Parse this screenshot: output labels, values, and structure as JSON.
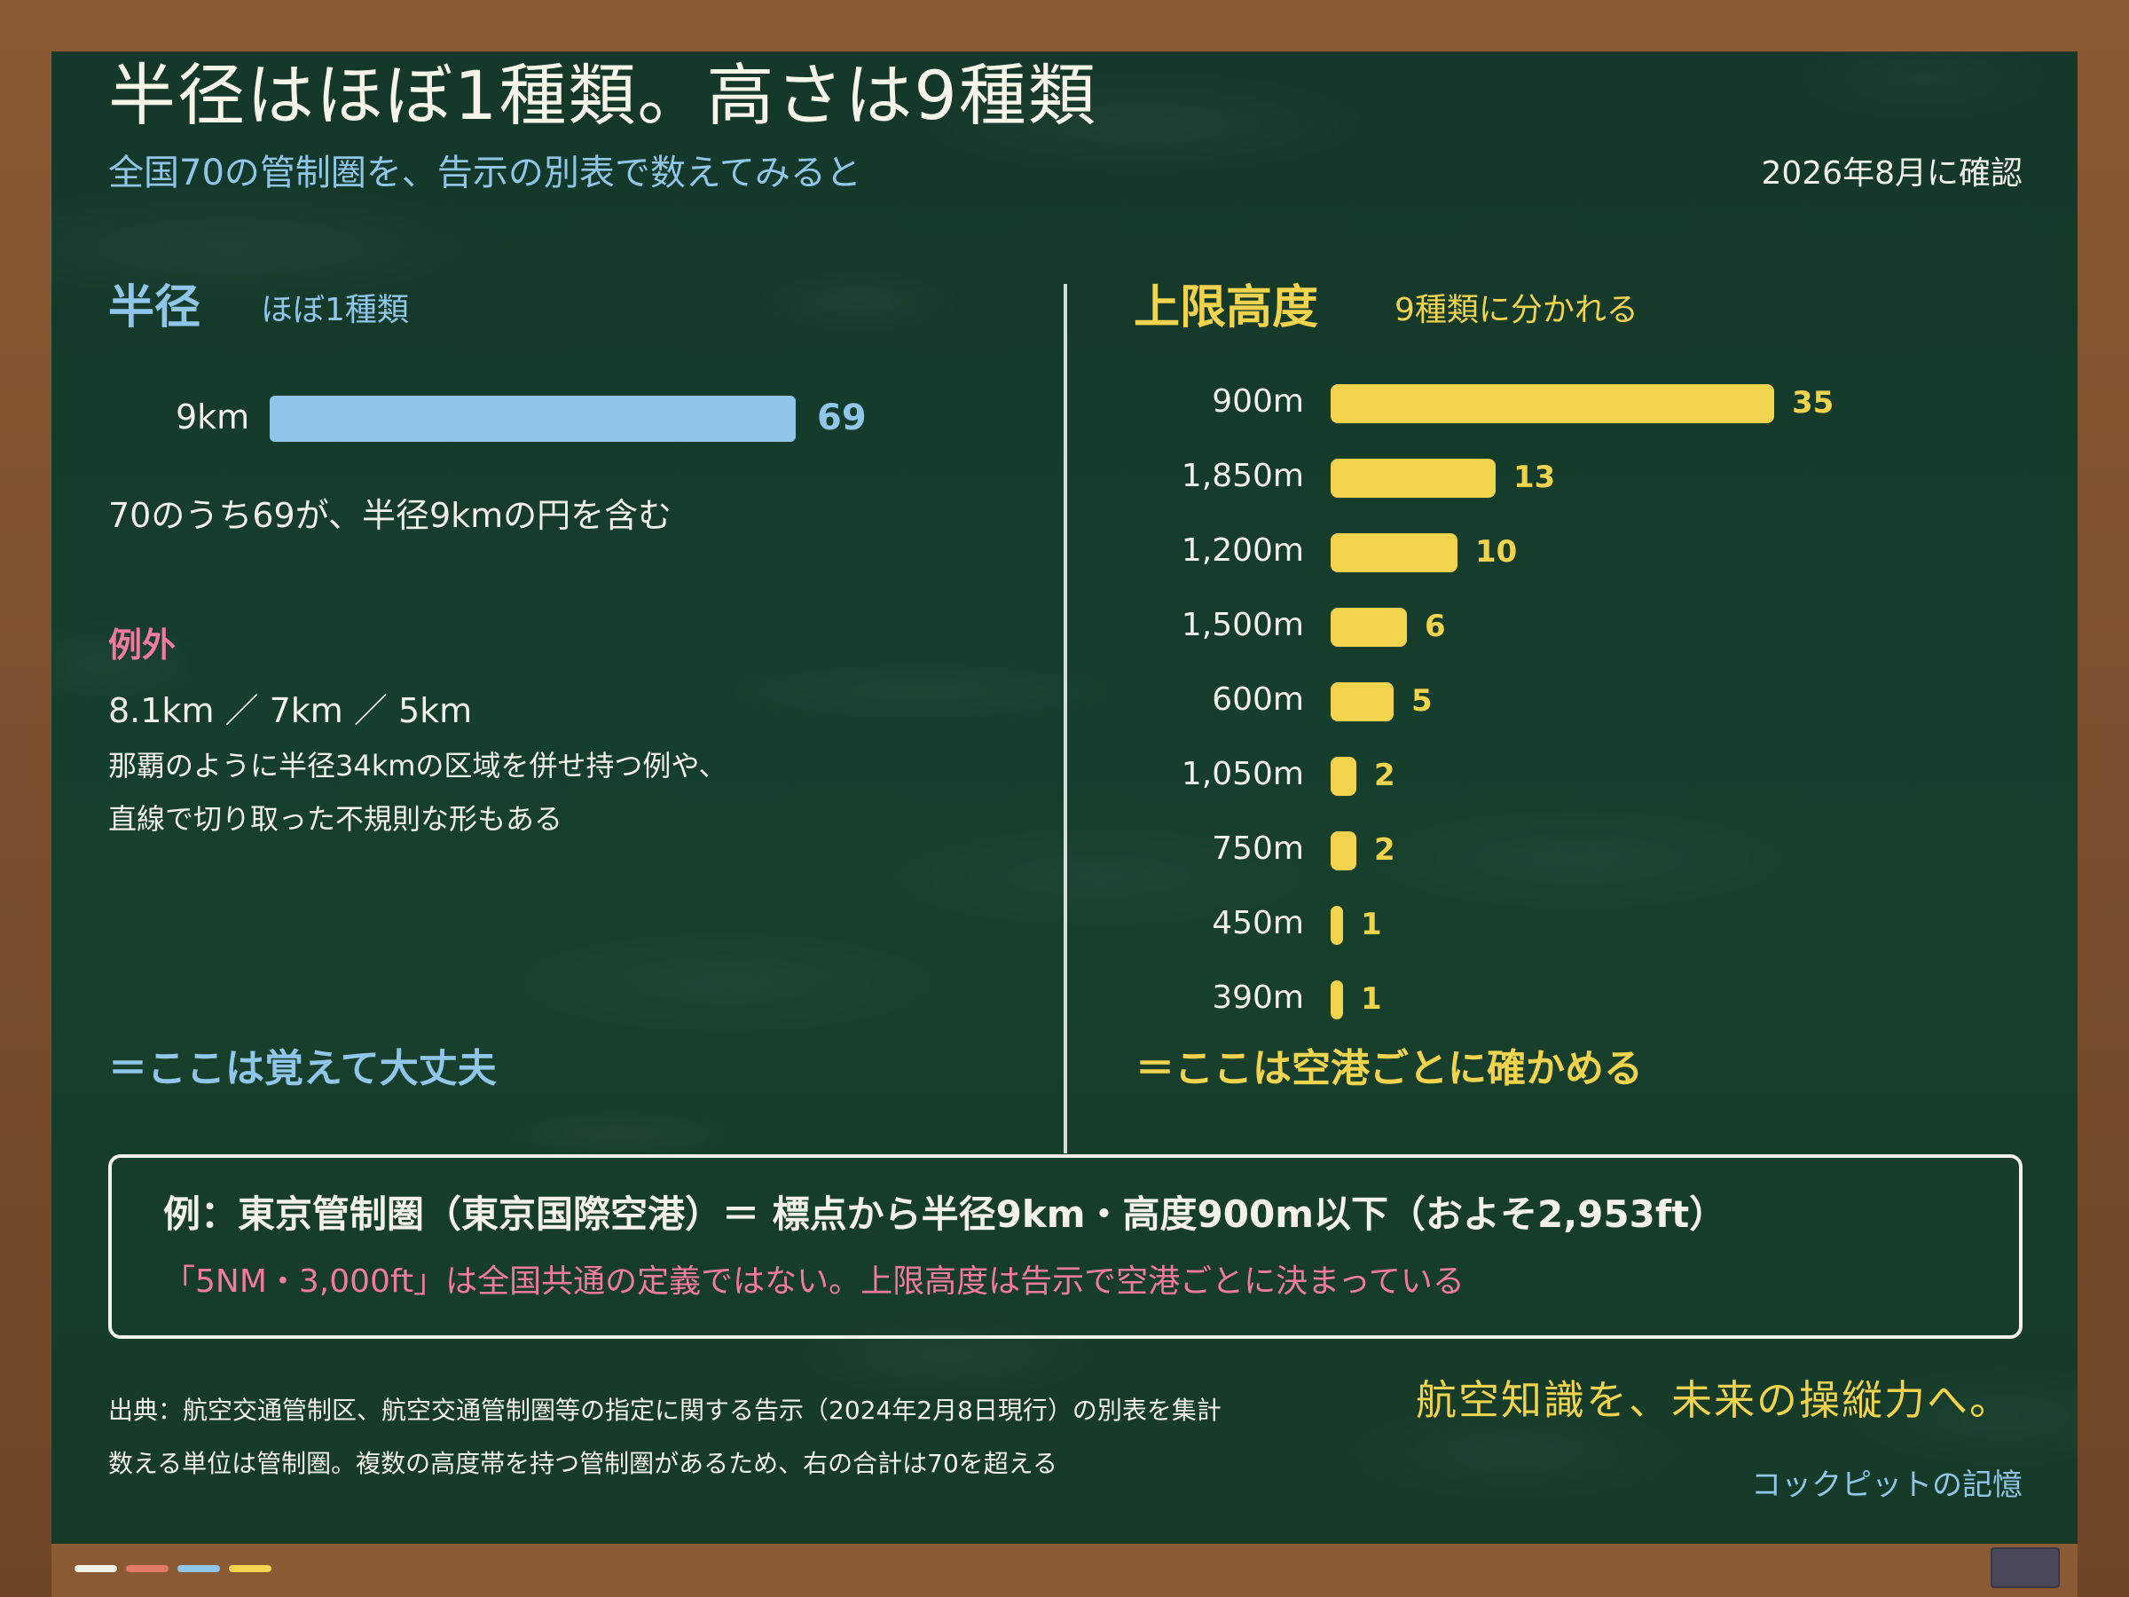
{
  "title": "半径はほぼ1種類。高さは9種類",
  "subtitle": "全国70の管制圏を、告示の別表で数えてみると",
  "date_note": "2026年8月に確認",
  "radius_section": {
    "heading": "半径",
    "subheading": "ほぼ1種類",
    "note": "70のうち69が、半径9kmの円を含む",
    "exceptions_heading": "例外",
    "exceptions_values": "8.1km ／ 7km ／ 5km",
    "exceptions_desc_line1": "那覇のように半径34kmの区域を併せ持つ例や、",
    "exceptions_desc_line2": "直線で切り取った不規則な形もある",
    "footer": "＝ここは覚えて大丈夫"
  },
  "altitude_section": {
    "heading": "上限高度",
    "subheading": "9種類に分かれる",
    "footer": "＝ここは空港ごとに確かめる"
  },
  "chart_data": [
    {
      "type": "bar",
      "orientation": "horizontal",
      "categories": [
        "9km"
      ],
      "values": [
        69
      ],
      "xlim": [
        0,
        70
      ],
      "color": "#8fc6ea"
    },
    {
      "type": "bar",
      "orientation": "horizontal",
      "categories": [
        "900m",
        "1,850m",
        "1,200m",
        "1,500m",
        "600m",
        "1,050m",
        "750m",
        "450m",
        "390m"
      ],
      "values": [
        35,
        13,
        10,
        6,
        5,
        2,
        2,
        1,
        1
      ],
      "xlim": [
        0,
        35
      ],
      "color": "#f2d34e"
    }
  ],
  "example": {
    "main": "例：東京管制圏（東京国際空港）＝ 標点から半径9km・高度900m以下（およそ2,953ft）",
    "note": "「5NM・3,000ft」は全国共通の定義ではない。上限高度は告示で空港ごとに決まっている"
  },
  "source_line1": "出典：航空交通管制区、航空交通管制圏等の指定に関する告示（2024年2月8日現行）の別表を集計",
  "source_line2": "数える単位は管制圏。複数の高度帯を持つ管制圏があるため、右の合計は70を超える",
  "slogan": "航空知識を、未来の操縦力へ。",
  "brand": "コックピットの記憶",
  "colors": {
    "board": "#173b29",
    "frame": "#7b5030",
    "radius_accent": "#8fc6ea",
    "altitude_accent": "#f2d34e",
    "warning_pink": "#f07b9d",
    "chalk_white": "#f3f1ea"
  },
  "chalk_pieces": [
    "#f3f1ea",
    "#e07a6a",
    "#8fc6ea",
    "#f2d34e"
  ]
}
